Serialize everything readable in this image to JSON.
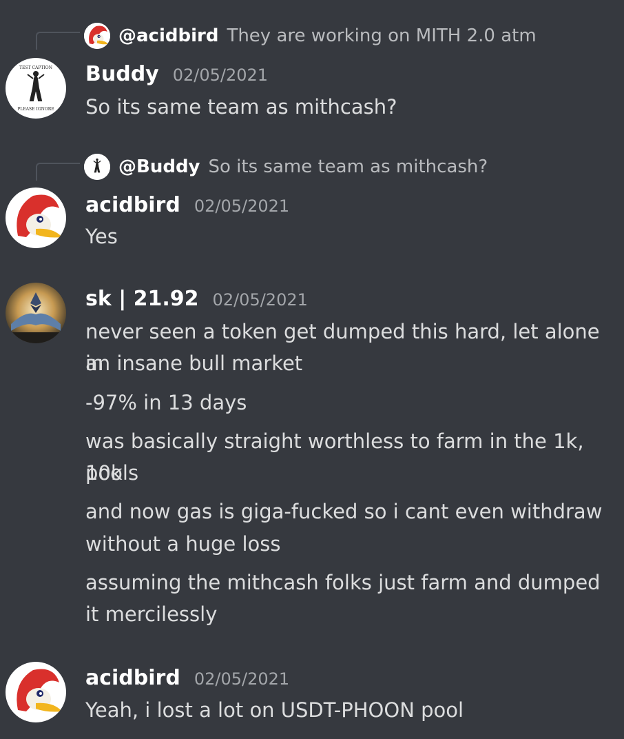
{
  "messages": [
    {
      "reply": {
        "mention": "@acidbird",
        "text": "They are working on MITH 2.0 atm"
      },
      "author": "Buddy",
      "timestamp": "02/05/2021",
      "lines": [
        "So its same team as mithcash?"
      ]
    },
    {
      "reply": {
        "mention": "@Buddy",
        "text": "So its same team as mithcash?"
      },
      "author": "acidbird",
      "timestamp": "02/05/2021",
      "lines": [
        "Yes"
      ]
    },
    {
      "author": "sk | 21.92",
      "timestamp": "02/05/2021",
      "lines": [
        "never seen a token get dumped this hard, let alone in",
        "an insane bull market",
        "-97% in 13 days",
        "was basically straight worthless to farm in the 1k, 10k",
        "pools",
        "and now gas is giga-fucked so i cant even withdraw",
        "without a huge loss",
        "assuming the mithcash folks just farm and  dumped",
        "it mercilessly"
      ]
    },
    {
      "author": "acidbird",
      "timestamp": "02/05/2021",
      "lines": [
        "Yeah, i lost a lot on USDT-PHOON pool"
      ]
    }
  ],
  "avatars": {
    "buddy": {
      "icon": "buddy-avatar-image",
      "top_text": "TEST CAPTION",
      "bottom_text": "PLEASE IGNORE"
    },
    "acidbird": {
      "icon": "woody-woodpecker-avatar"
    },
    "sk": {
      "icon": "ethereum-avatar"
    }
  },
  "colors": {
    "background": "#36393f",
    "username": "#ffffff",
    "text": "#dcddde",
    "muted": "#a3a6aa"
  }
}
